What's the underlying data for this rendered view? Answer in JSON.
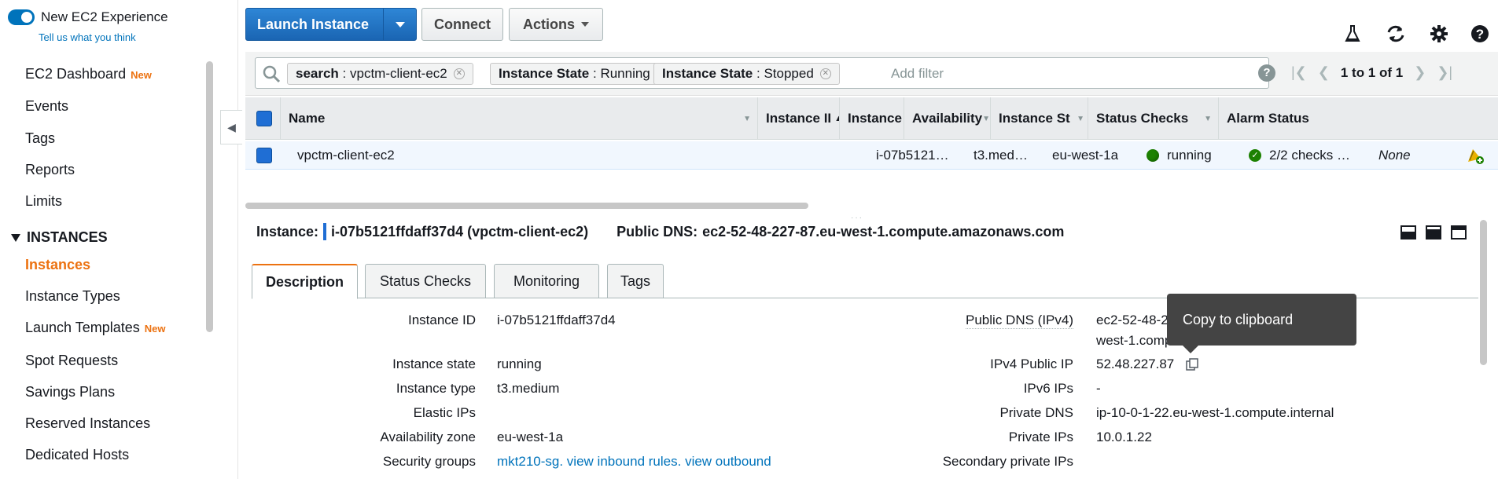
{
  "sidebar": {
    "toggle_label": "New EC2 Experience",
    "feedback_link": "Tell us what you think",
    "items": [
      {
        "label": "EC2 Dashboard",
        "badge": "New"
      },
      {
        "label": "Events"
      },
      {
        "label": "Tags"
      },
      {
        "label": "Reports"
      },
      {
        "label": "Limits"
      }
    ],
    "section": "INSTANCES",
    "section_items": [
      {
        "label": "Instances",
        "active": true
      },
      {
        "label": "Instance Types"
      },
      {
        "label": "Launch Templates",
        "badge": "New"
      },
      {
        "label": "Spot Requests"
      },
      {
        "label": "Savings Plans"
      },
      {
        "label": "Reserved Instances"
      },
      {
        "label": "Dedicated Hosts"
      }
    ]
  },
  "toolbar": {
    "launch_label": "Launch Instance",
    "connect_label": "Connect",
    "actions_label": "Actions",
    "icons": [
      "flask-icon",
      "refresh-icon",
      "gear-icon",
      "help-icon"
    ]
  },
  "filter": {
    "tokens": [
      {
        "key": "search",
        "value": "vpctm-client-ec2"
      },
      {
        "key": "Instance State",
        "value": "Running"
      },
      {
        "key": "Instance State",
        "value": "Stopped"
      }
    ],
    "placeholder": "Add filter",
    "pager_text": "1 to 1 of 1"
  },
  "grid": {
    "columns": [
      "Name",
      "Instance II",
      "Instance",
      "Availability",
      "Instance St",
      "Status Checks",
      "Alarm Status"
    ],
    "row": {
      "name": "vpctm-client-ec2",
      "instance_id": "i-07b5121…",
      "instance_type": "t3.med…",
      "availability": "eu-west-1a",
      "state": "running",
      "status_checks": "2/2 checks …",
      "alarm_status": "None"
    }
  },
  "details": {
    "instance_label": "Instance:",
    "instance_value": "i-07b5121ffdaff37d4 (vpctm-client-ec2)",
    "dns_label": "Public DNS:",
    "dns_value": "ec2-52-48-227-87.eu-west-1.compute.amazonaws.com",
    "tabs": [
      "Description",
      "Status Checks",
      "Monitoring",
      "Tags"
    ],
    "active_tab": "Description",
    "left": [
      {
        "label": "Instance ID",
        "value": "i-07b5121ffdaff37d4"
      },
      {
        "label": "Instance state",
        "value": "running"
      },
      {
        "label": "Instance type",
        "value": "t3.medium"
      },
      {
        "label": "Elastic IPs",
        "value": ""
      },
      {
        "label": "Availability zone",
        "value": "eu-west-1a"
      },
      {
        "label": "Security groups",
        "value": "mkt210-sg. view inbound rules. view outbound"
      }
    ],
    "right": [
      {
        "label": "Public DNS (IPv4)",
        "value": "ec2-52-48-2",
        "value2": "west-1.comp"
      },
      {
        "label": "IPv4 Public IP",
        "value": "52.48.227.87"
      },
      {
        "label": "IPv6 IPs",
        "value": "-"
      },
      {
        "label": "Private DNS",
        "value": "ip-10-0-1-22.eu-west-1.compute.internal"
      },
      {
        "label": "Private IPs",
        "value": "10.0.1.22"
      },
      {
        "label": "Secondary private IPs",
        "value": ""
      }
    ],
    "tooltip": "Copy to clipboard"
  },
  "colors": {
    "accent": "#ec7211",
    "primary": "#1a65b3",
    "link": "#0073bb",
    "ok": "#1d8102"
  }
}
